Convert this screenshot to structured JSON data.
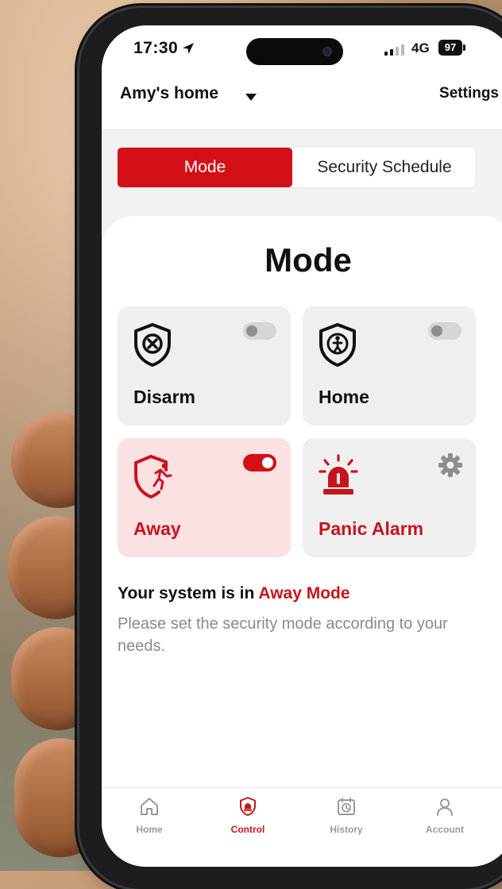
{
  "status_bar": {
    "time": "17:30",
    "network": "4G",
    "battery": "97"
  },
  "header": {
    "home_name": "Amy's home",
    "settings_label": "Settings"
  },
  "tabs": [
    {
      "label": "Mode",
      "active": true
    },
    {
      "label": "Security Schedule",
      "active": false
    }
  ],
  "mode_section": {
    "title": "Mode",
    "cards": [
      {
        "label": "Disarm",
        "icon": "shield-x-icon",
        "toggle_on": false
      },
      {
        "label": "Home",
        "icon": "shield-person-icon",
        "toggle_on": false
      },
      {
        "label": "Away",
        "icon": "shield-running-icon",
        "toggle_on": true
      },
      {
        "label": "Panic Alarm",
        "icon": "siren-icon",
        "has_settings": true
      }
    ],
    "status_prefix": "Your system is in",
    "status_mode": "Away Mode",
    "hint": "Please set the security mode according to your needs."
  },
  "bottom_nav": [
    {
      "label": "Home",
      "icon": "home-icon",
      "active": false
    },
    {
      "label": "Control",
      "icon": "control-shield-icon",
      "active": true
    },
    {
      "label": "History",
      "icon": "history-icon",
      "active": false
    },
    {
      "label": "Account",
      "icon": "account-icon",
      "active": false
    }
  ],
  "colors": {
    "accent": "#d40f17",
    "active_card_bg": "#fbe1e2",
    "muted_text": "#8a8a8e"
  }
}
